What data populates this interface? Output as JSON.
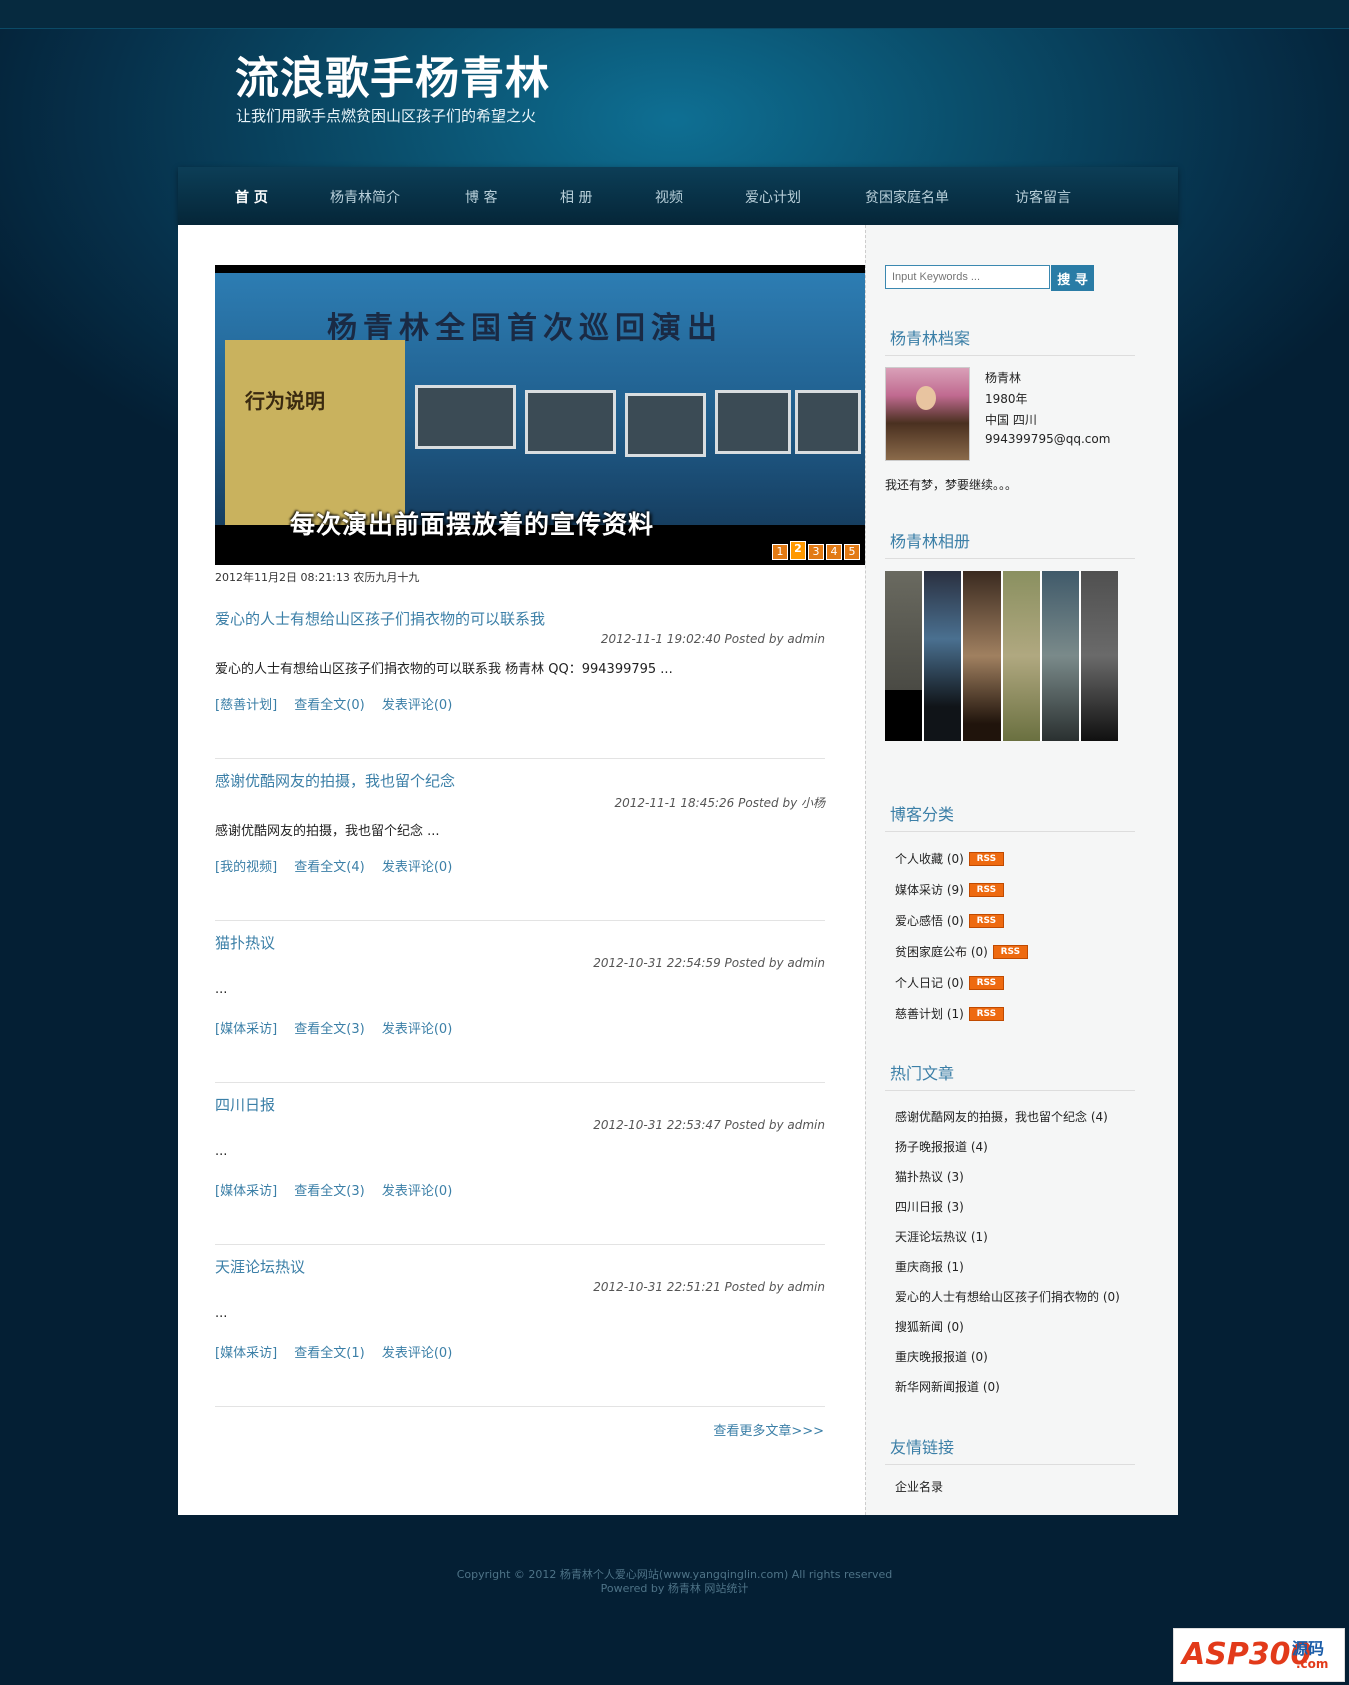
{
  "site": {
    "title": "流浪歌手杨青林",
    "subtitle": "让我们用歌手点燃贫困山区孩子们的希望之火"
  },
  "nav": [
    {
      "label": "首 页"
    },
    {
      "label": "杨青林简介"
    },
    {
      "label": "博 客"
    },
    {
      "label": "相 册"
    },
    {
      "label": "视频"
    },
    {
      "label": "爱心计划"
    },
    {
      "label": "贫困家庭名单"
    },
    {
      "label": "访客留言"
    }
  ],
  "slideshow": {
    "banner_title": "杨青林全国首次巡回演出",
    "banner_side": "行为说明",
    "caption": "每次演出前面摆放着的宣传资料",
    "pages": [
      "1",
      "2",
      "3",
      "4",
      "5"
    ],
    "current_page": "2"
  },
  "date_line": "2012年11月2日 08:21:13 农历九月十九",
  "posts": [
    {
      "title": "爱心的人士有想给山区孩子们捐衣物的可以联系我",
      "meta": "2012-11-1 19:02:40  Posted by admin",
      "excerpt": "爱心的人士有想给山区孩子们捐衣物的可以联系我 杨青林 QQ：994399795 ...",
      "category": "[慈善计划]",
      "read": "查看全文(0)",
      "comment": "发表评论(0)"
    },
    {
      "title": "感谢优酷网友的拍摄，我也留个纪念",
      "meta": "2012-11-1 18:45:26  Posted by 小杨",
      "excerpt": "感谢优酷网友的拍摄，我也留个纪念 ...",
      "category": "[我的视频]",
      "read": "查看全文(4)",
      "comment": "发表评论(0)"
    },
    {
      "title": "猫扑热议",
      "meta": "2012-10-31 22:54:59  Posted by admin",
      "excerpt": "...",
      "category": "[媒体采访]",
      "read": "查看全文(3)",
      "comment": "发表评论(0)"
    },
    {
      "title": "四川日报",
      "meta": "2012-10-31 22:53:47  Posted by admin",
      "excerpt": "...",
      "category": "[媒体采访]",
      "read": "查看全文(3)",
      "comment": "发表评论(0)"
    },
    {
      "title": "天涯论坛热议",
      "meta": "2012-10-31 22:51:21  Posted by admin",
      "excerpt": "...",
      "category": "[媒体采访]",
      "read": "查看全文(1)",
      "comment": "发表评论(0)"
    }
  ],
  "more_link": "查看更多文章>>>",
  "search": {
    "placeholder": "Input Keywords ...",
    "button": "搜 寻"
  },
  "profile": {
    "heading": "杨青林档案",
    "name": "杨青林",
    "year": "1980年",
    "location": "中国 四川",
    "email": "994399795@qq.com",
    "motto": "我还有梦，梦要继续。。。"
  },
  "album": {
    "heading": "杨青林相册"
  },
  "categories": {
    "heading": "博客分类",
    "rss_label": "RSS",
    "items": [
      {
        "label": "个人收藏 (0)"
      },
      {
        "label": "媒体采访 (9)"
      },
      {
        "label": "爱心感悟 (0)"
      },
      {
        "label": "贫困家庭公布 (0)"
      },
      {
        "label": "个人日记 (0)"
      },
      {
        "label": "慈善计划 (1)"
      }
    ]
  },
  "hot": {
    "heading": "热门文章",
    "items": [
      {
        "label": "感谢优酷网友的拍摄，我也留个纪念 (4)"
      },
      {
        "label": "扬子晚报报道 (4)"
      },
      {
        "label": "猫扑热议 (3)"
      },
      {
        "label": "四川日报 (3)"
      },
      {
        "label": "天涯论坛热议 (1)"
      },
      {
        "label": "重庆商报 (1)"
      },
      {
        "label": "爱心的人士有想给山区孩子们捐衣物的 (0)"
      },
      {
        "label": "搜狐新闻 (0)"
      },
      {
        "label": "重庆晚报报道 (0)"
      },
      {
        "label": "新华网新闻报道 (0)"
      }
    ]
  },
  "links": {
    "heading": "友情链接",
    "items": [
      {
        "label": "企业名录"
      }
    ]
  },
  "footer": {
    "copyright": "Copyright © 2012 杨青林个人爱心网站(www.yangqinglin.com) All rights reserved",
    "powered": "Powered by 杨青林 网站统计"
  },
  "watermark": {
    "brand": "ASP300",
    "label": "源码",
    "domain": ".com"
  }
}
